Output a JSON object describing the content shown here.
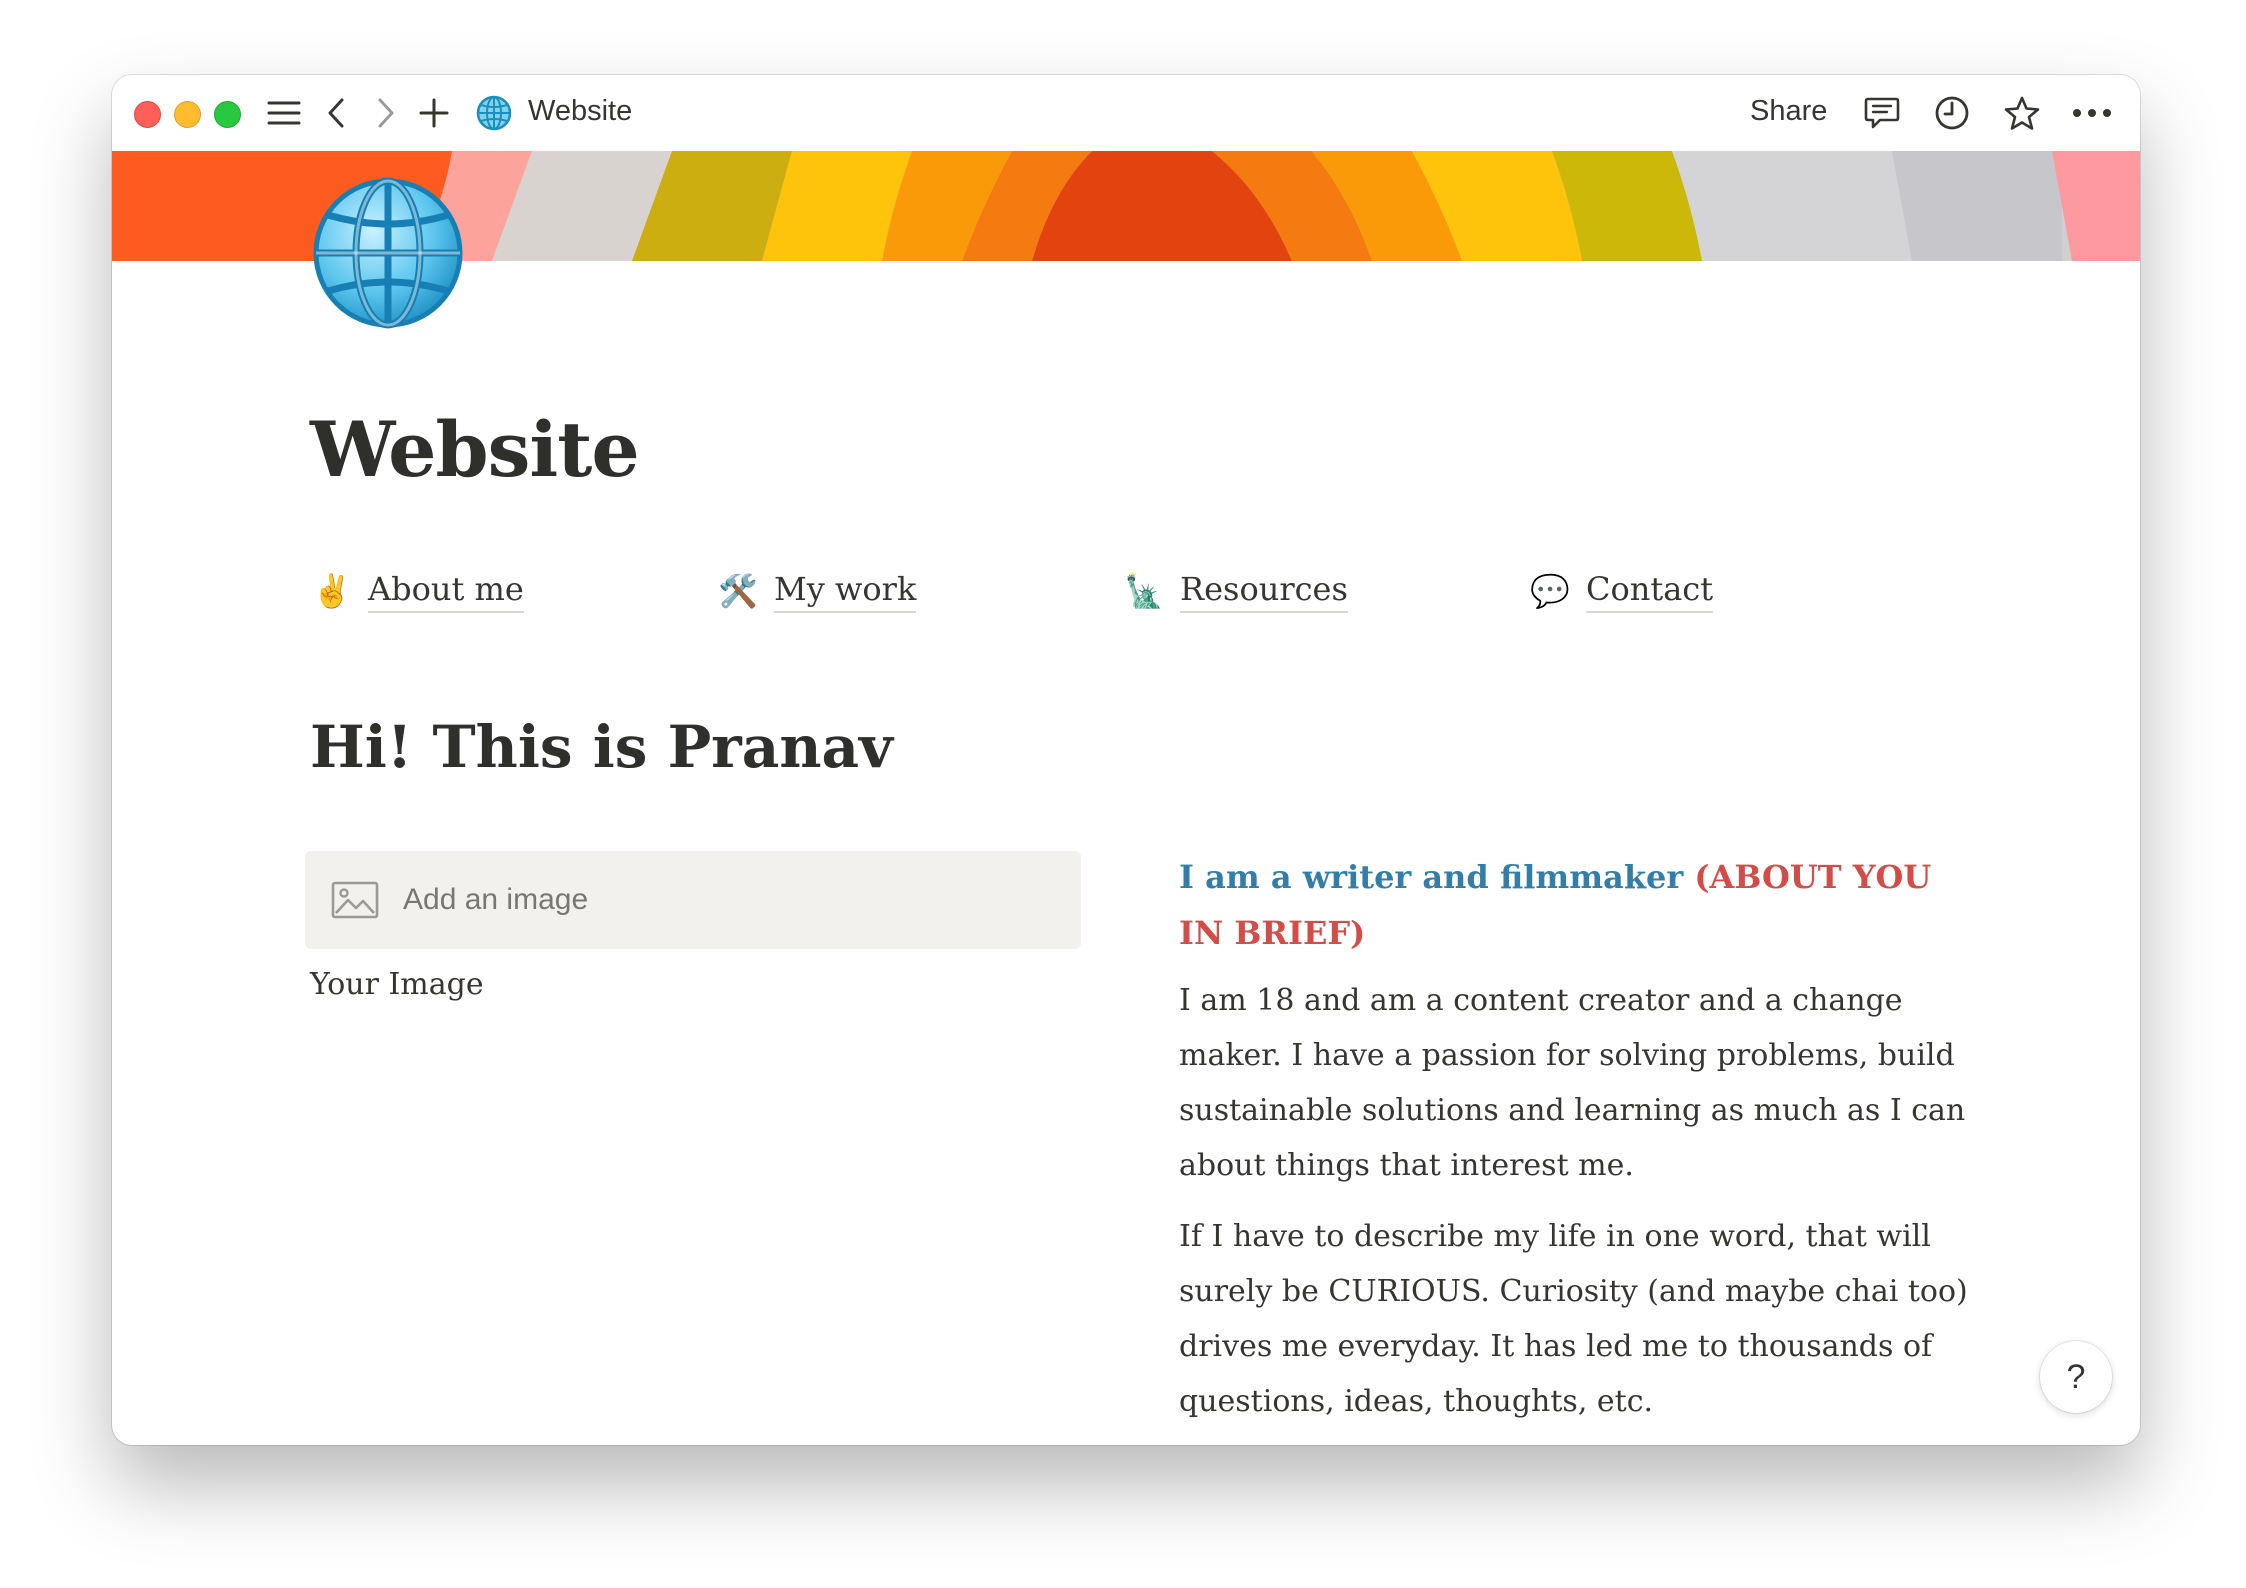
{
  "window": {
    "title": "Website",
    "share_label": "Share",
    "toolbar_icons": [
      "menu-icon",
      "back-icon",
      "forward-icon",
      "plus-icon",
      "globe-icon",
      "comment-icon",
      "history-icon",
      "star-icon",
      "more-icon"
    ]
  },
  "page": {
    "icon": "globe-icon",
    "title": "Website",
    "nav": [
      {
        "emoji": "✌️",
        "icon": "victory-hand-icon",
        "label": "About me"
      },
      {
        "emoji": "🛠️",
        "icon": "tools-icon",
        "label": "My work"
      },
      {
        "emoji": "🗽",
        "icon": "statue-of-liberty-icon",
        "label": "Resources"
      },
      {
        "emoji": "💬",
        "icon": "speech-bubble-icon",
        "label": "Contact"
      }
    ],
    "heading": "Hi! This is Pranav",
    "image_block": {
      "label": "Add an image",
      "caption": "Your Image"
    },
    "about": {
      "subheading_blue": "I am a writer and filmmaker",
      "subheading_red": "(ABOUT YOU IN BRIEF)",
      "paragraphs": [
        "I am 18 and am a content creator and a change maker. I have a passion for solving problems, build sustainable solutions and learning as much as I can about things that interest me.",
        "If I have to describe my life in one word, that will surely be CURIOUS. Curiosity (and maybe chai too) drives me everyday. It has led me to thousands of questions, ideas, thoughts, etc."
      ]
    },
    "help_label": "?"
  },
  "colors": {
    "text": "#37352f",
    "blue": "#337ea9",
    "red": "#d44c47",
    "image_block_bg": "#f2f1ee"
  }
}
